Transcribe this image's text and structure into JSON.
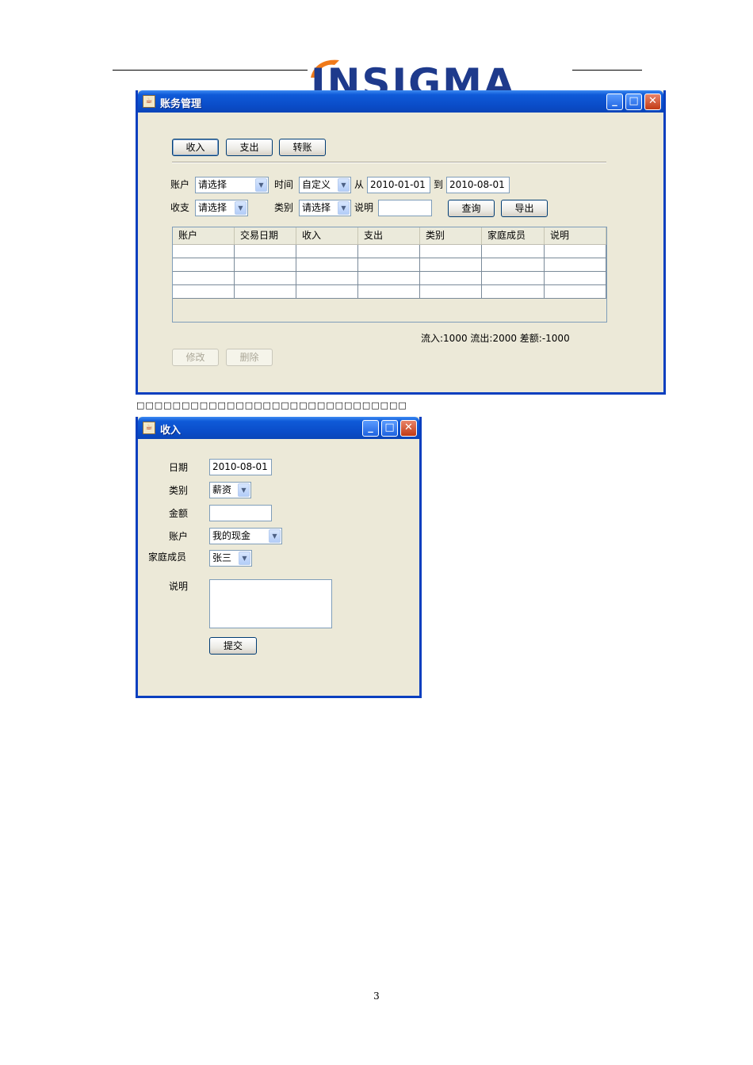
{
  "header": {
    "logo_text": "INSIGMA"
  },
  "main_window": {
    "title": "账务管理",
    "title_buttons": {
      "minimize": "_",
      "maximize": "□",
      "close": "✕"
    },
    "toolbar": {
      "income": "收入",
      "expense": "支出",
      "transfer": "转账"
    },
    "filters": {
      "account_label": "账户",
      "account_value": "请选择",
      "time_label": "时间",
      "time_value": "自定义",
      "from_label": "从",
      "from_value": "2010-01-01",
      "to_label": "到",
      "to_value": "2010-08-01",
      "inout_label": "收支",
      "inout_value": "请选择",
      "category_label": "类别",
      "category_value": "请选择",
      "note_label": "说明",
      "note_value": "",
      "query_button": "查询",
      "export_button": "导出"
    },
    "table": {
      "columns": [
        "账户",
        "交易日期",
        "收入",
        "支出",
        "类别",
        "家庭成员",
        "说明"
      ],
      "rows": [
        [
          "",
          "",
          "",
          "",
          "",
          "",
          ""
        ],
        [
          "",
          "",
          "",
          "",
          "",
          "",
          ""
        ],
        [
          "",
          "",
          "",
          "",
          "",
          "",
          ""
        ],
        [
          "",
          "",
          "",
          "",
          "",
          "",
          ""
        ]
      ]
    },
    "summary": "流入:1000 流出:2000 差额:-1000",
    "actions": {
      "edit": "修改",
      "delete": "删除"
    }
  },
  "garbled_caption": "□□□□□□□□□□□□□□□□□□□□□□□□□□□□□□",
  "income_window": {
    "title": "收入",
    "title_buttons": {
      "minimize": "_",
      "maximize": "□",
      "close": "✕"
    },
    "form": {
      "date_label": "日期",
      "date_value": "2010-08-01",
      "category_label": "类别",
      "category_value": "薪资",
      "amount_label": "金额",
      "amount_value": "",
      "account_label": "账户",
      "account_value": "我的现金",
      "member_label": "家庭成员",
      "member_value": "张三",
      "note_label": "说明",
      "note_value": "",
      "submit_button": "提交"
    }
  },
  "page_number": "3"
}
